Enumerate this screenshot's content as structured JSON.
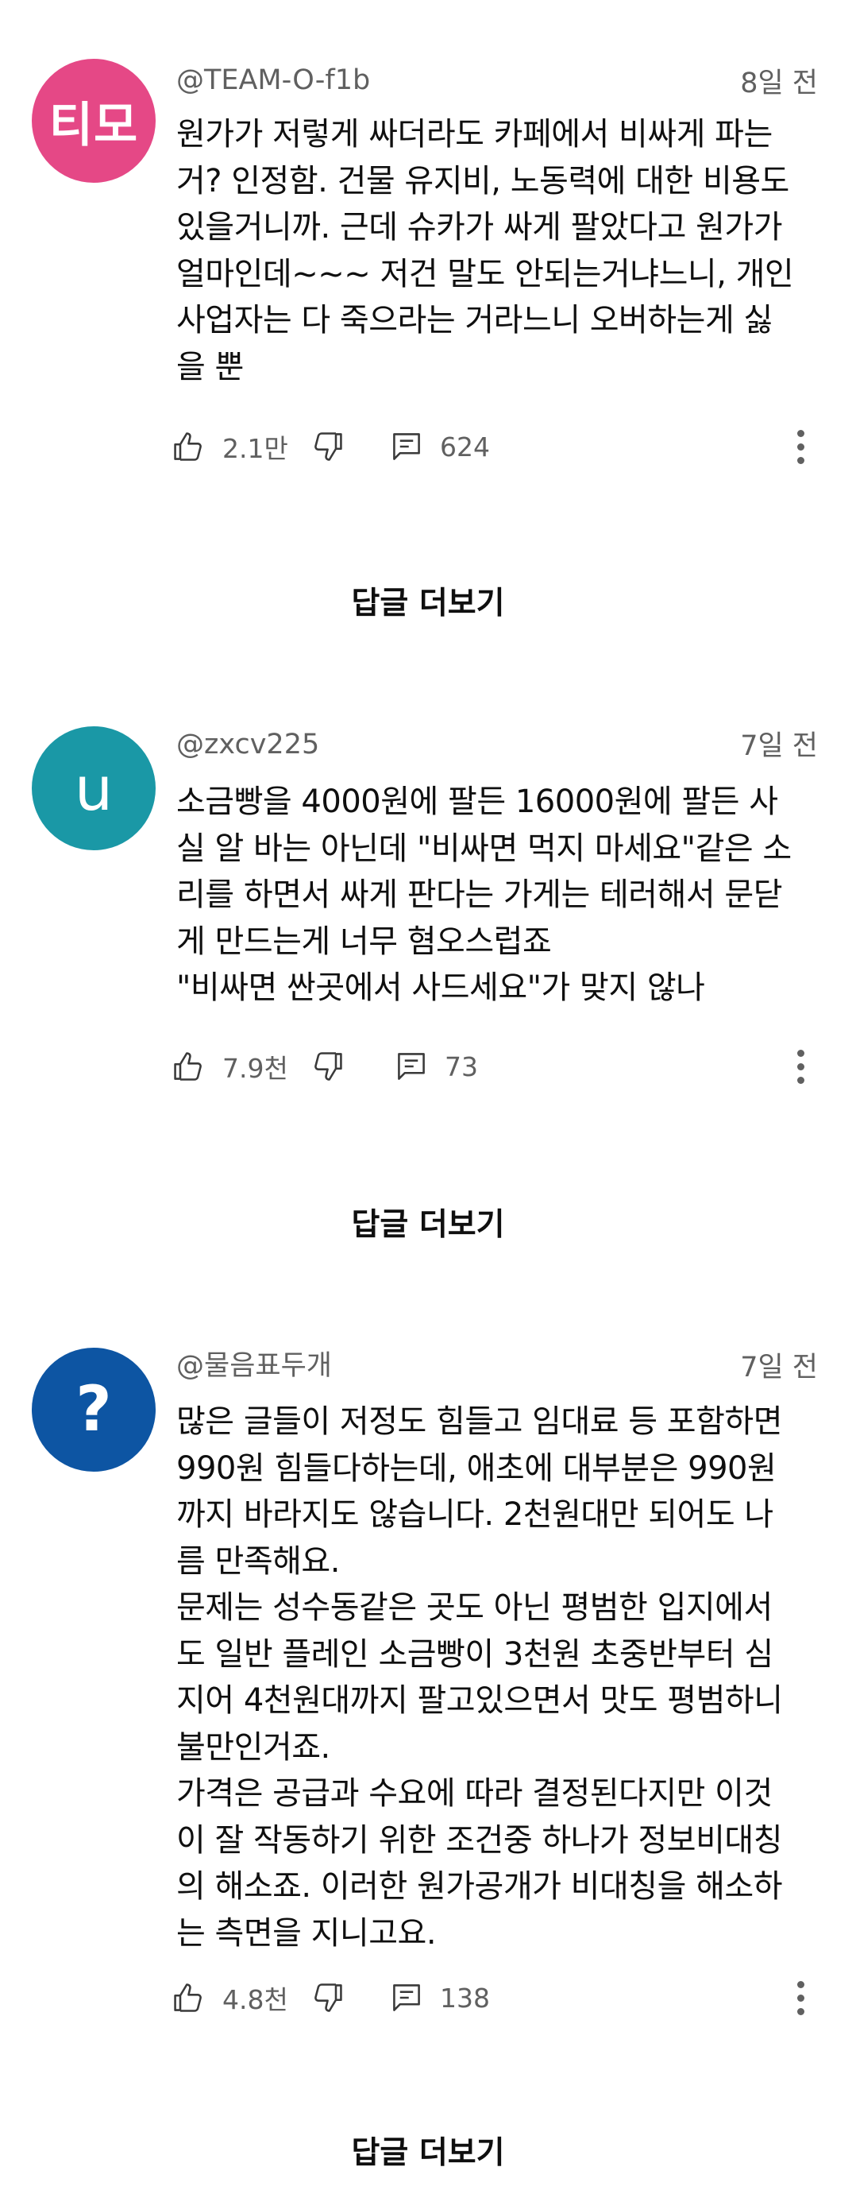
{
  "comments": [
    {
      "avatar_text": "티모",
      "avatar_color": "#E54886",
      "handle": "@TEAM-O-f1b",
      "time": "8일 전",
      "body": "원가가 저렇게 싸더라도 카페에서 비싸게 파는\n거? 인정함. 건물 유지비, 노동력에 대한 비용도\n있을거니까. 근데 슈카가 싸게 팔았다고 원가가\n얼마인데~~~ 저건 말도 안되는거냐느니, 개인\n사업자는 다 죽으라는 거라느니 오버하는게 싫\n을 뿐",
      "likes": "2.1만",
      "replies": "624",
      "more_replies": "답글 더보기"
    },
    {
      "avatar_text": "u",
      "avatar_color": "#1A98A6",
      "handle": "@zxcv225",
      "time": "7일 전",
      "body": "소금빵을 4000원에 팔든 16000원에 팔든 사\n실 알 바는 아닌데 \"비싸면 먹지 마세요\"같은 소\n리를 하면서 싸게 판다는 가게는 테러해서 문닫\n게 만드는게 너무 혐오스럽죠\n\"비싸면 싼곳에서 사드세요\"가 맞지 않나",
      "likes": "7.9천",
      "replies": "73",
      "more_replies": "답글 더보기"
    },
    {
      "avatar_text": "?",
      "avatar_color": "#0D55A3",
      "handle": "@물음표두개",
      "time": "7일 전",
      "body": "많은 글들이 저정도 힘들고 임대료 등 포함하면\n990원 힘들다하는데, 애초에 대부분은 990원\n까지 바라지도 않습니다. 2천원대만 되어도 나\n름 만족해요.\n문제는 성수동같은 곳도 아닌 평범한 입지에서\n도 일반 플레인 소금빵이 3천원 초중반부터 심\n지어 4천원대까지 팔고있으면서 맛도 평범하니\n불만인거죠.\n가격은 공급과 수요에 따라 결정된다지만 이것\n이 잘 작동하기 위한 조건중 하나가 정보비대칭\n의 해소죠. 이러한 원가공개가 비대칭을 해소하\n는 측면을 지니고요.",
      "likes": "4.8천",
      "replies": "138",
      "more_replies": "답글 더보기"
    }
  ],
  "icons": {
    "like": "thumbs-up-icon",
    "dislike": "thumbs-down-icon",
    "reply": "comment-icon",
    "menu": "more-vert-icon"
  }
}
